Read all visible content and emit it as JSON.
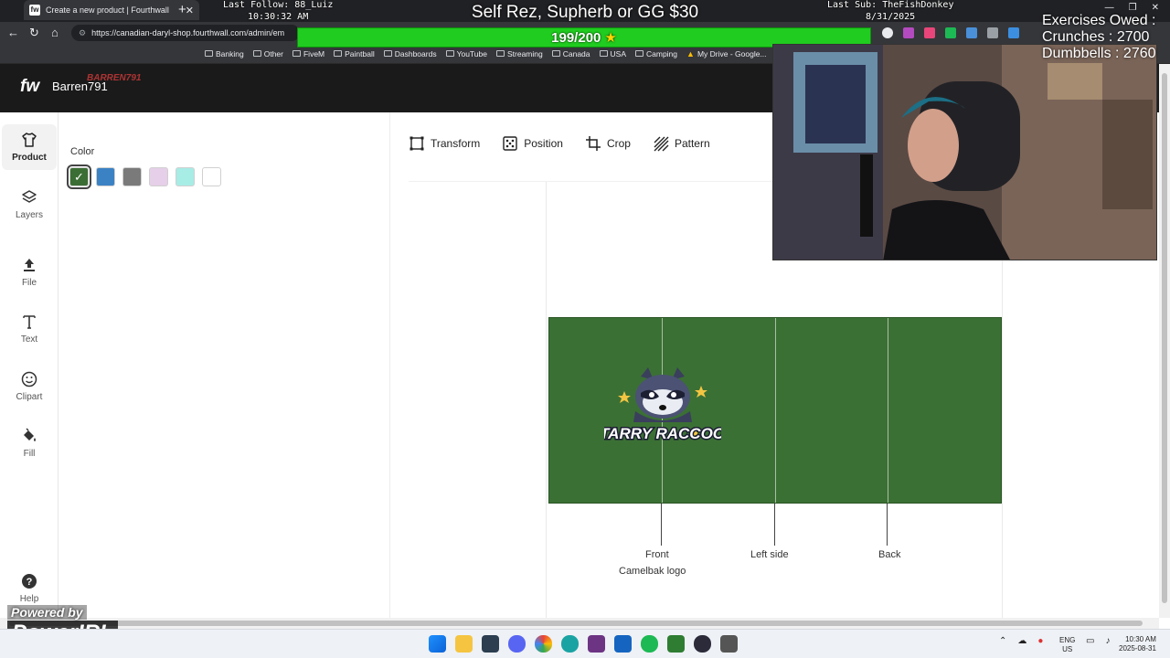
{
  "browser": {
    "tab_title": "Create a new product | Fourthwall",
    "url": "https://canadian-daryl-shop.fourthwall.com/admin/em",
    "bookmarks": [
      "Banking",
      "Other",
      "FiveM",
      "Paintball",
      "Dashboards",
      "YouTube",
      "Streaming",
      "Canada",
      "USA",
      "Camping",
      "My Drive - Google..."
    ]
  },
  "app": {
    "logo": "fw",
    "shop_name": "Barren791"
  },
  "rail": {
    "items": [
      {
        "label": "Product",
        "icon": "tshirt-icon"
      },
      {
        "label": "Layers",
        "icon": "layers-icon"
      },
      {
        "label": "File",
        "icon": "upload-icon"
      },
      {
        "label": "Text",
        "icon": "text-icon"
      },
      {
        "label": "Clipart",
        "icon": "smiley-icon"
      },
      {
        "label": "Fill",
        "icon": "paint-bucket-icon"
      }
    ],
    "help_label": "Help"
  },
  "panel": {
    "color_title": "Color",
    "swatches": [
      "#3b6e34",
      "#3b82c4",
      "#7a7a7a",
      "#e6cfe8",
      "#a8ece6",
      "#ffffff"
    ],
    "selected_index": 0
  },
  "toolbar": {
    "transform": "Transform",
    "position": "Position",
    "crop": "Crop",
    "pattern": "Pattern"
  },
  "canvas": {
    "wrap_color": "#3b7034",
    "logo_text": "STARRY RACCOON",
    "labels": {
      "front": "Front",
      "front_sub": "Camelbak logo",
      "left": "Left side",
      "back": "Back"
    }
  },
  "overlay": {
    "last_follow": "Last Follow: 88_Luiz",
    "follow_time": "10:30:32 AM",
    "title": "Self Rez, Supherb or GG $30",
    "last_sub": "Last Sub: TheFishDonkey",
    "sub_date": "8/31/2025",
    "goal": "199/200",
    "exercises_title": "Exercises Owed :",
    "crunches": "Crunches : 2700",
    "dumbbells": "Dumbbells : 2760",
    "watermark": "BARREN791",
    "powered_by": "Powered by",
    "powered_logo": "PowerIRL"
  },
  "taskbar": {
    "lang_1": "ENG",
    "lang_2": "US",
    "time": "10:30 AM",
    "date": "2025-08-31"
  }
}
